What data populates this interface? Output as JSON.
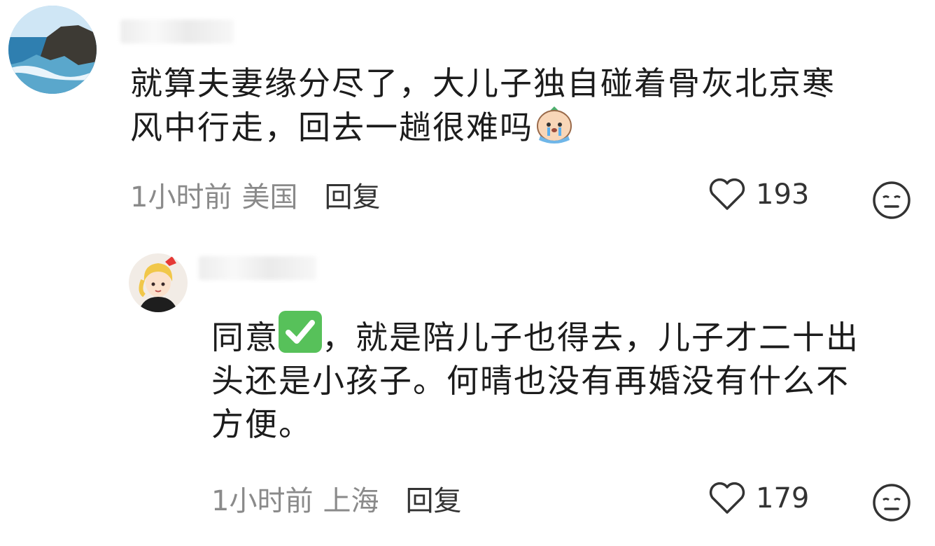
{
  "comments": [
    {
      "text_lines": [
        "就算夫妻缘分尽了，大儿子独自碰着骨灰北京寒",
        "风中行走，回去一趟很难吗"
      ],
      "emoji": "crying-emoji",
      "time": "1小时前",
      "location": "美国",
      "reply_label": "回复",
      "likes": "193"
    },
    {
      "text_prefix": "同意",
      "emoji": "check-mark-emoji",
      "text_lines": [
        "，就是陪儿子也得去，儿子才二十出",
        "头还是小孩子。何晴也没有再婚没有什么不",
        "方便。"
      ],
      "time": "1小时前",
      "location": "上海",
      "reply_label": "回复",
      "likes": "179"
    }
  ],
  "icons": {
    "like": "heart-outline-icon",
    "dislike": "neutral-face-icon"
  },
  "colors": {
    "text": "#1c1c1c",
    "meta": "#8a8a8a",
    "check_green": "#57c15a"
  }
}
